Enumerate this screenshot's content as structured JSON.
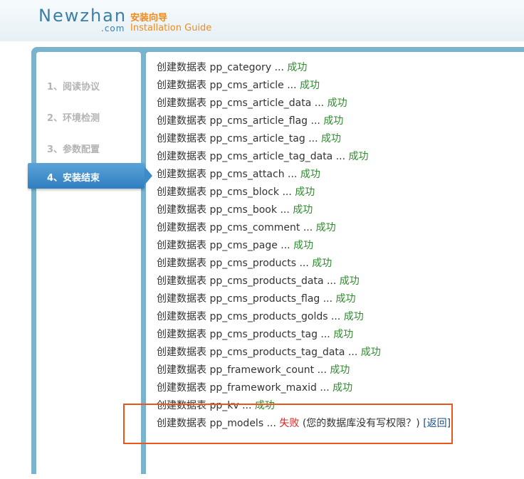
{
  "header": {
    "logo_main": "Newzhan",
    "logo_sub": ".com",
    "title_cn": "安装向导",
    "title_en": "Installation Guide"
  },
  "steps": [
    {
      "label": "1、阅读协议",
      "active": false
    },
    {
      "label": "2、环境检测",
      "active": false
    },
    {
      "label": "3、参数配置",
      "active": false
    },
    {
      "label": "4、安装结束",
      "active": true
    }
  ],
  "log": {
    "prefix": "创建数据表",
    "ellipsis": "...",
    "success_text": "成功",
    "fail_text": "失败",
    "tables": [
      "pp_category",
      "pp_cms_article",
      "pp_cms_article_data",
      "pp_cms_article_flag",
      "pp_cms_article_tag",
      "pp_cms_article_tag_data",
      "pp_cms_attach",
      "pp_cms_block",
      "pp_cms_book",
      "pp_cms_comment",
      "pp_cms_page",
      "pp_cms_products",
      "pp_cms_products_data",
      "pp_cms_products_flag",
      "pp_cms_products_golds",
      "pp_cms_products_tag",
      "pp_cms_products_tag_data",
      "pp_framework_count",
      "pp_framework_maxid",
      "pp_kv"
    ],
    "failed_table": "pp_models",
    "fail_message": "(您的数据库没有写权限？)",
    "back_link": "[返回]"
  },
  "colors": {
    "brand_blue": "#3b7fa8",
    "guide_orange": "#f08a1c",
    "frame_blue": "#7ab3cb",
    "active_step": "#3d8bc9",
    "success_green": "#2e8b2e",
    "fail_red": "#e02020",
    "highlight_orange": "#e8561c"
  }
}
